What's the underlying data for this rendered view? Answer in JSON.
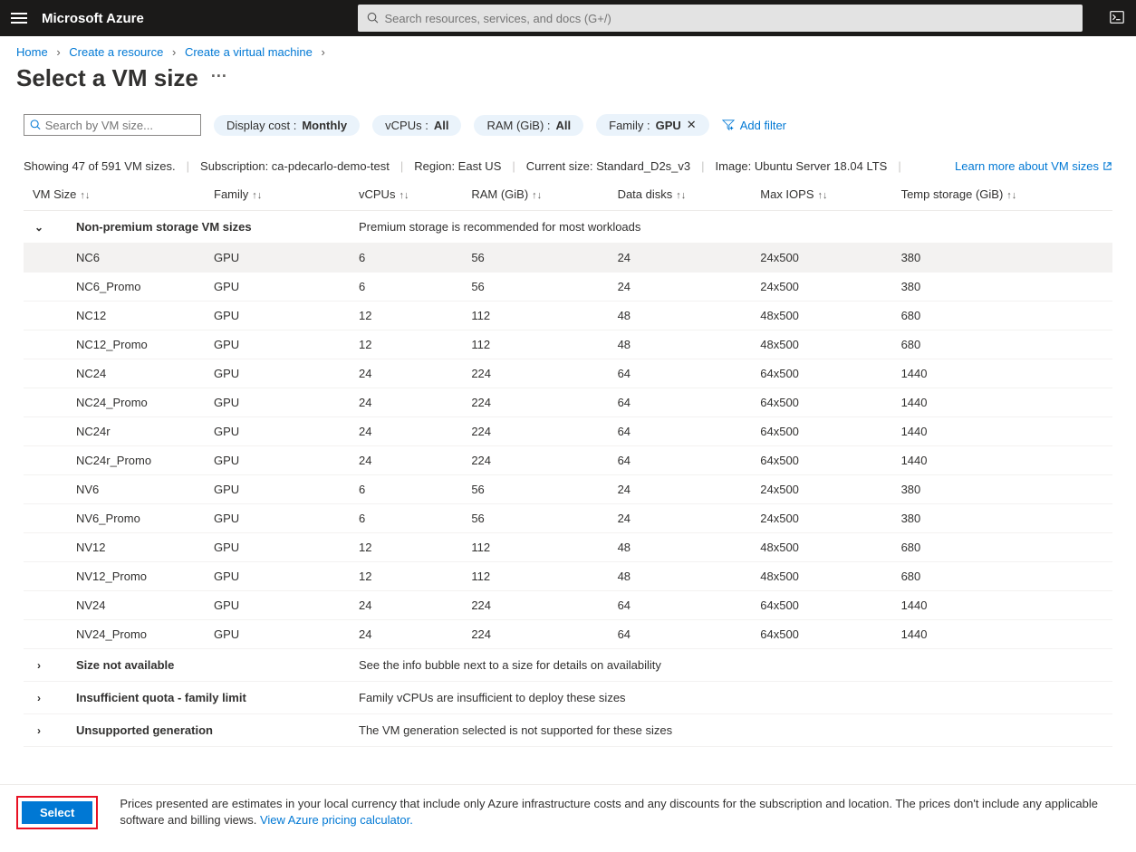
{
  "header": {
    "brand": "Microsoft Azure",
    "search_placeholder": "Search resources, services, and docs (G+/)"
  },
  "breadcrumb": [
    "Home",
    "Create a resource",
    "Create a virtual machine"
  ],
  "page_title": "Select a VM size",
  "filters": {
    "search_placeholder": "Search by VM size...",
    "pills": {
      "display_cost": {
        "label": "Display cost :",
        "value": "Monthly"
      },
      "vcpus": {
        "label": "vCPUs :",
        "value": "All"
      },
      "ram": {
        "label": "RAM (GiB) :",
        "value": "All"
      },
      "family": {
        "label": "Family :",
        "value": "GPU",
        "removable": true
      }
    },
    "add_filter": "Add filter"
  },
  "info": {
    "showing": "Showing 47 of 591 VM sizes.",
    "subscription": "Subscription: ca-pdecarlo-demo-test",
    "region": "Region: East US",
    "current_size": "Current size: Standard_D2s_v3",
    "image": "Image: Ubuntu Server 18.04 LTS",
    "learn_more": "Learn more about VM sizes"
  },
  "columns": [
    "VM Size",
    "Family",
    "vCPUs",
    "RAM (GiB)",
    "Data disks",
    "Max IOPS",
    "Temp storage (GiB)"
  ],
  "group1": {
    "name": "Non-premium storage VM sizes",
    "desc": "Premium storage is recommended for most workloads"
  },
  "rows": [
    {
      "size": "NC6",
      "family": "GPU",
      "vcpus": "6",
      "ram": "56",
      "disks": "24",
      "iops": "24x500",
      "temp": "380",
      "selected": true
    },
    {
      "size": "NC6_Promo",
      "family": "GPU",
      "vcpus": "6",
      "ram": "56",
      "disks": "24",
      "iops": "24x500",
      "temp": "380"
    },
    {
      "size": "NC12",
      "family": "GPU",
      "vcpus": "12",
      "ram": "112",
      "disks": "48",
      "iops": "48x500",
      "temp": "680"
    },
    {
      "size": "NC12_Promo",
      "family": "GPU",
      "vcpus": "12",
      "ram": "112",
      "disks": "48",
      "iops": "48x500",
      "temp": "680"
    },
    {
      "size": "NC24",
      "family": "GPU",
      "vcpus": "24",
      "ram": "224",
      "disks": "64",
      "iops": "64x500",
      "temp": "1440"
    },
    {
      "size": "NC24_Promo",
      "family": "GPU",
      "vcpus": "24",
      "ram": "224",
      "disks": "64",
      "iops": "64x500",
      "temp": "1440"
    },
    {
      "size": "NC24r",
      "family": "GPU",
      "vcpus": "24",
      "ram": "224",
      "disks": "64",
      "iops": "64x500",
      "temp": "1440"
    },
    {
      "size": "NC24r_Promo",
      "family": "GPU",
      "vcpus": "24",
      "ram": "224",
      "disks": "64",
      "iops": "64x500",
      "temp": "1440"
    },
    {
      "size": "NV6",
      "family": "GPU",
      "vcpus": "6",
      "ram": "56",
      "disks": "24",
      "iops": "24x500",
      "temp": "380"
    },
    {
      "size": "NV6_Promo",
      "family": "GPU",
      "vcpus": "6",
      "ram": "56",
      "disks": "24",
      "iops": "24x500",
      "temp": "380"
    },
    {
      "size": "NV12",
      "family": "GPU",
      "vcpus": "12",
      "ram": "112",
      "disks": "48",
      "iops": "48x500",
      "temp": "680"
    },
    {
      "size": "NV12_Promo",
      "family": "GPU",
      "vcpus": "12",
      "ram": "112",
      "disks": "48",
      "iops": "48x500",
      "temp": "680"
    },
    {
      "size": "NV24",
      "family": "GPU",
      "vcpus": "24",
      "ram": "224",
      "disks": "64",
      "iops": "64x500",
      "temp": "1440"
    },
    {
      "size": "NV24_Promo",
      "family": "GPU",
      "vcpus": "24",
      "ram": "224",
      "disks": "64",
      "iops": "64x500",
      "temp": "1440"
    }
  ],
  "collapsed_groups": [
    {
      "name": "Size not available",
      "desc": "See the info bubble next to a size for details on availability"
    },
    {
      "name": "Insufficient quota - family limit",
      "desc": "Family vCPUs are insufficient to deploy these sizes"
    },
    {
      "name": "Unsupported generation",
      "desc": "The VM generation selected is not supported for these sizes"
    }
  ],
  "footer": {
    "select_label": "Select",
    "text": "Prices presented are estimates in your local currency that include only Azure infrastructure costs and any discounts for the subscription and location. The prices don't include any applicable software and billing views. ",
    "link": "View Azure pricing calculator."
  }
}
